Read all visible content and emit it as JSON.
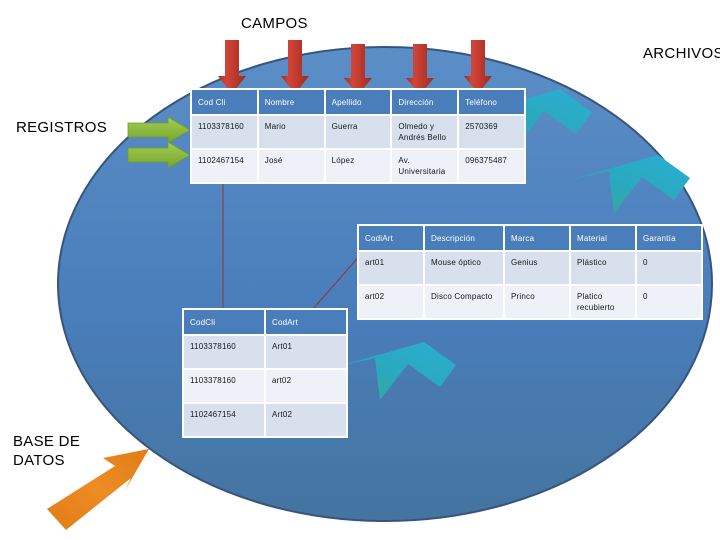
{
  "diagram": {
    "shape_name": "base-de-datos-ellipse",
    "colors": {
      "ellipse_fill": "#4a7ebb",
      "ellipse_stroke": "#37577f",
      "header_blue": "#4a7ebb",
      "row_light": "#d8e0ed",
      "row_lighter": "#eef1f7",
      "red_arrow": "#c0392b",
      "green_arrow": "#8cba3f",
      "teal_arrow": "#2aa9bd",
      "orange_arrow": "#e8821e",
      "connector_line": "#8e3a3a"
    }
  },
  "labels": {
    "campos": "CAMPOS",
    "archivos": "ARCHIVOS",
    "registros": "REGISTROS",
    "base_de_datos": "BASE DE\nDATOS"
  },
  "tables": {
    "clientes": {
      "name": "clientes-table",
      "headers": [
        "Cod Cli",
        "Nombre",
        "Apellido",
        "Dirección",
        "Teléfono"
      ],
      "rows": [
        [
          "1103378160",
          "Mario",
          "Guerra",
          "Olmedo y Andrés Bello",
          "2570369"
        ],
        [
          "1102467154",
          "José",
          "López",
          "Av. Universitaria",
          "096375487"
        ]
      ]
    },
    "articulos": {
      "name": "articulos-table",
      "headers": [
        "CodiArt",
        "Descripción",
        "Marca",
        "Material",
        "Garantía"
      ],
      "rows": [
        [
          "art01",
          "Mouse óptico",
          "Genius",
          "Plástico",
          "0"
        ],
        [
          "art02",
          "Disco Compacto",
          "Princo",
          "Platico recubierto",
          "0"
        ]
      ]
    },
    "relacion": {
      "name": "relacion-table",
      "headers": [
        "CodCli",
        "CodArt"
      ],
      "rows": [
        [
          "1103378160",
          "Art01"
        ],
        [
          "1103378160",
          "art02"
        ],
        [
          "1102467154",
          "Art02"
        ]
      ]
    }
  },
  "arrows": {
    "red_count": 5,
    "green_count": 2,
    "teal_count": 3,
    "orange_count": 1
  }
}
